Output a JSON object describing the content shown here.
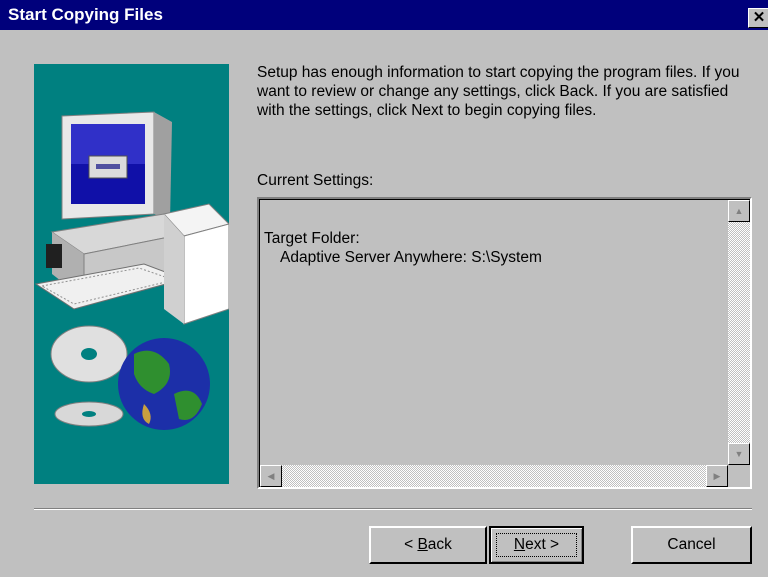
{
  "window": {
    "title": "Start Copying Files",
    "close_glyph": "✕"
  },
  "description": "Setup has enough information to start copying the program files. If you want to review or change any settings, click Back.  If you are satisfied with the settings, click Next to begin copying files.",
  "current_settings": {
    "label": "Current Settings:",
    "lines": [
      "Target Folder:",
      "Adaptive Server Anywhere: S:\\System"
    ]
  },
  "buttons": {
    "back_prefix": "< ",
    "back_mnemonic": "B",
    "back_rest": "ack",
    "next_mnemonic": "N",
    "next_rest": "ext >",
    "cancel": "Cancel"
  },
  "colors": {
    "titlebar": "#00007b",
    "dialog": "#c0c0c0",
    "art_bg": "#008080"
  },
  "icons": {
    "up": "scroll-up-arrow-icon",
    "down": "scroll-down-arrow-icon",
    "left": "scroll-left-arrow-icon",
    "right": "scroll-right-arrow-icon",
    "close": "close-icon"
  }
}
